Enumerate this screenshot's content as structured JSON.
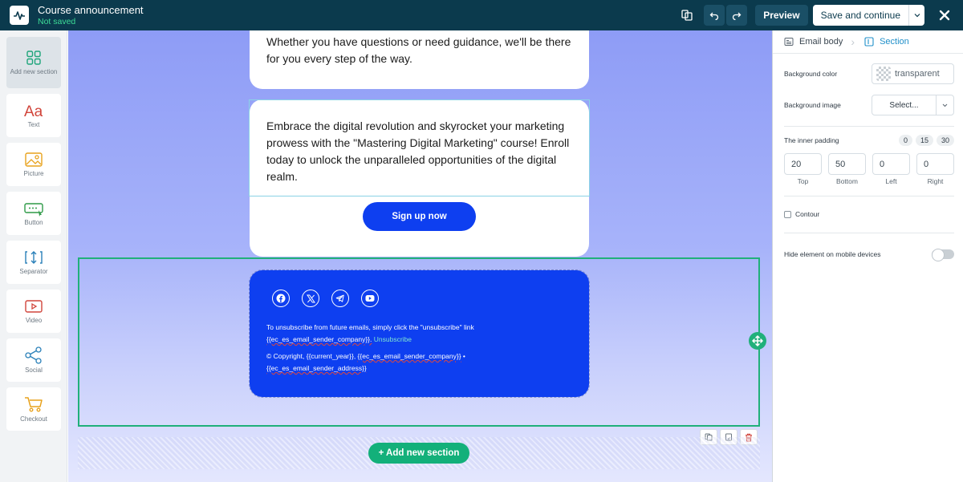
{
  "header": {
    "title": "Course announcement",
    "status": "Not saved",
    "preview_label": "Preview",
    "save_label": "Save and continue"
  },
  "tools": [
    {
      "label": "Add new section",
      "icon": "grid-icon"
    },
    {
      "label": "Text",
      "icon": "text-icon"
    },
    {
      "label": "Picture",
      "icon": "picture-icon"
    },
    {
      "label": "Button",
      "icon": "button-icon"
    },
    {
      "label": "Separator",
      "icon": "separator-icon"
    },
    {
      "label": "Video",
      "icon": "video-icon"
    },
    {
      "label": "Social",
      "icon": "share-icon"
    },
    {
      "label": "Checkout",
      "icon": "cart-icon"
    }
  ],
  "canvas": {
    "top_text": "Whether you have questions or need guidance, we'll be there for you every step of the way.",
    "mid_text": "Embrace the digital revolution and skyrocket your marketing prowess with the \"Mastering Digital Marketing\" course! Enroll today to unlock the unparalleled opportunities of the digital realm.",
    "signup_label": "Sign up now",
    "footer": {
      "unsub_text": "To unsubscribe from future emails, simply click the \"unsubscribe\" link",
      "sender_company_tag": "{{ec_es_email_sender_company}}.",
      "unsub_link": "Unsubscribe",
      "copyright_prefix": "© Copyright, ",
      "current_year_tag": "{{current_year}}",
      "comma": ", ",
      "company_tag": "{{ec_es_email_sender_company}}",
      "bullet": " •",
      "address_tag": "{{ec_es_email_sender_address}}"
    },
    "add_section_label": "+ Add new section"
  },
  "panel": {
    "tab_email_body": "Email body",
    "tab_section": "Section",
    "bg_color_label": "Background color",
    "bg_color_value": "transparent",
    "bg_image_label": "Background image",
    "bg_image_value": "Select...",
    "padding_label": "The inner padding",
    "padding_presets": [
      "0",
      "15",
      "30"
    ],
    "padding": [
      {
        "value": "20",
        "label": "Top"
      },
      {
        "value": "50",
        "label": "Bottom"
      },
      {
        "value": "0",
        "label": "Left"
      },
      {
        "value": "0",
        "label": "Right"
      }
    ],
    "contour_label": "Contour",
    "hide_mobile_label": "Hide element on mobile devices"
  },
  "colors": {
    "topbar": "#0b3a4d",
    "accent_green": "#20b07a",
    "email_blue": "#0e3ff0",
    "tab_active": "#1f8fc9"
  }
}
